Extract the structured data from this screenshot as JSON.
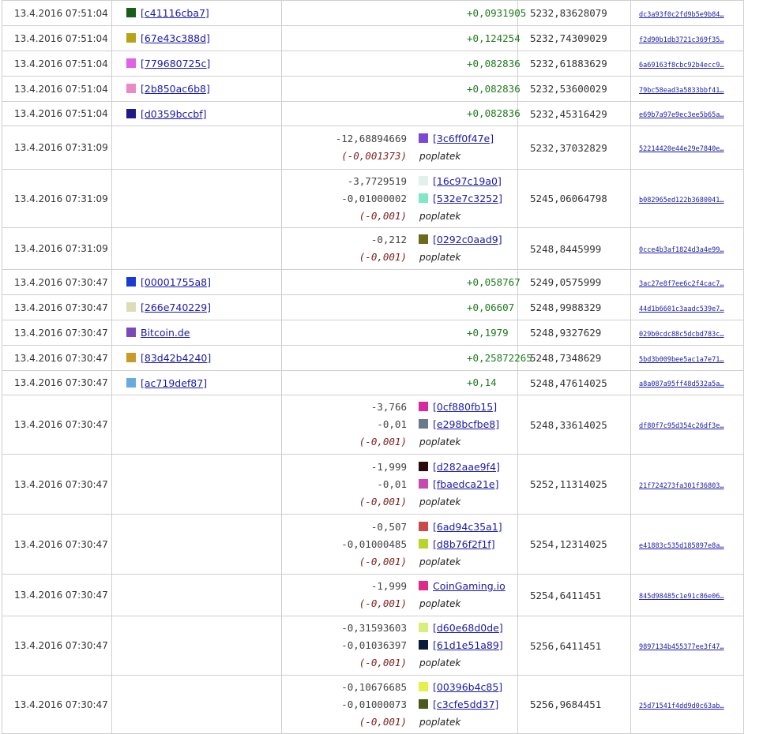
{
  "rows": [
    {
      "date": "13.4.2016 07:51:04",
      "wallet_color": "#1a5c1a",
      "wallet": "[c41116cba7]",
      "amount": "+0,0931905",
      "balance": "5232,83628079",
      "txid": "dc3a93f0c2fd9b5e9b84…"
    },
    {
      "date": "13.4.2016 07:51:04",
      "wallet_color": "#b8a21a",
      "wallet": "[67e43c388d]",
      "amount": "+0,124254",
      "balance": "5232,74309029",
      "txid": "f2d90b1db3721c369f35…"
    },
    {
      "date": "13.4.2016 07:51:04",
      "wallet_color": "#e060e6",
      "wallet": "[779680725c]",
      "amount": "+0,082836",
      "balance": "5232,61883629",
      "txid": "6a69163f8cbc92b4ecc9…"
    },
    {
      "date": "13.4.2016 07:51:04",
      "wallet_color": "#e88ac6",
      "wallet": "[2b850ac6b8]",
      "amount": "+0,082836",
      "balance": "5232,53600029",
      "txid": "79bc58ead3a5833bbf41…"
    },
    {
      "date": "13.4.2016 07:51:04",
      "wallet_color": "#1e1a8a",
      "wallet": "[d0359bccbf]",
      "amount": "+0,082836",
      "balance": "5232,45316429",
      "txid": "e69b7a97e9ec3ee5b65a…"
    },
    {
      "date": "13.4.2016 07:31:09",
      "outs": [
        {
          "amount": "-12,68894669",
          "color": "#7a4ad6",
          "addr": "[3c6ff0f47e]"
        }
      ],
      "fee": "(-0,001373)",
      "fee_label": "poplatek",
      "balance": "5232,37032829",
      "txid": "52214420e44e29e7840e…"
    },
    {
      "date": "13.4.2016 07:31:09",
      "outs": [
        {
          "amount": "-3,7729519",
          "color": "#e0f0ea",
          "addr": "[16c97c19a0]"
        },
        {
          "amount": "-0,01000002",
          "color": "#7ee8c6",
          "addr": "[532e7c3252]"
        }
      ],
      "fee": "(-0,001)",
      "fee_label": "poplatek",
      "balance": "5245,06064798",
      "txid": "b082965ed122b3680041…"
    },
    {
      "date": "13.4.2016 07:31:09",
      "outs": [
        {
          "amount": "-0,212",
          "color": "#6a6a1a",
          "addr": "[0292c0aad9]"
        }
      ],
      "fee": "(-0,001)",
      "fee_label": "poplatek",
      "balance": "5248,8445999",
      "txid": "0cce4b3af1824d3a4e99…"
    },
    {
      "date": "13.4.2016 07:30:47",
      "wallet_color": "#1a3ad6",
      "wallet": "[00001755a8]",
      "amount": "+0,058767",
      "balance": "5249,0575999",
      "txid": "3ac27e8f7ee6c2f4cac7…"
    },
    {
      "date": "13.4.2016 07:30:47",
      "wallet_color": "#dedcb8",
      "wallet": "[266e740229]",
      "amount": "+0,06607",
      "balance": "5248,9988329",
      "txid": "44d1b6601c3aadc539e7…"
    },
    {
      "date": "13.4.2016 07:30:47",
      "wallet_color": "#7a4ab8",
      "wallet": "Bitcoin.de",
      "amount": "+0,1979",
      "balance": "5248,9327629",
      "txid": "029b0cdc88c5dcbd783c…"
    },
    {
      "date": "13.4.2016 07:30:47",
      "wallet_color": "#c89a2a",
      "wallet": "[83d42b4240]",
      "amount": "+0,25872265",
      "balance": "5248,7348629",
      "txid": "5bd3b009bee5ac1a7e71…"
    },
    {
      "date": "13.4.2016 07:30:47",
      "wallet_color": "#6aaade",
      "wallet": "[ac719def87]",
      "amount": "+0,14",
      "balance": "5248,47614025",
      "txid": "a8a087a95ff48d532a5a…"
    },
    {
      "date": "13.4.2016 07:30:47",
      "outs": [
        {
          "amount": "-3,766",
          "color": "#d62a9e",
          "addr": "[0cf880fb15]"
        },
        {
          "amount": "-0,01",
          "color": "#6a7a8a",
          "addr": "[e298bcfbe8]"
        }
      ],
      "fee": "(-0,001)",
      "fee_label": "poplatek",
      "balance": "5248,33614025",
      "txid": "df80f7c95d354c26df3e…"
    },
    {
      "date": "13.4.2016 07:30:47",
      "outs": [
        {
          "amount": "-1,999",
          "color": "#2a0a0a",
          "addr": "[d282aae9f4]"
        },
        {
          "amount": "-0,01",
          "color": "#c84ab0",
          "addr": "[fbaedca21e]"
        }
      ],
      "fee": "(-0,001)",
      "fee_label": "poplatek",
      "balance": "5252,11314025",
      "txid": "21f724273fa301f36803…"
    },
    {
      "date": "13.4.2016 07:30:47",
      "outs": [
        {
          "amount": "-0,507",
          "color": "#c84a4a",
          "addr": "[6ad94c35a1]"
        },
        {
          "amount": "-0,01000485",
          "color": "#b8d62a",
          "addr": "[d8b76f2f1f]"
        }
      ],
      "fee": "(-0,001)",
      "fee_label": "poplatek",
      "balance": "5254,12314025",
      "txid": "e41883c535d185897e8a…"
    },
    {
      "date": "13.4.2016 07:30:47",
      "outs": [
        {
          "amount": "-1,999",
          "color": "#e02a8a",
          "addr": "CoinGaming.io"
        }
      ],
      "fee": "(-0,001)",
      "fee_label": "poplatek",
      "balance": "5254,6411451",
      "txid": "845d98485c1e91c86e06…"
    },
    {
      "date": "13.4.2016 07:30:47",
      "outs": [
        {
          "amount": "-0,31593603",
          "color": "#d6f07a",
          "addr": "[d60e68d0de]"
        },
        {
          "amount": "-0,01036397",
          "color": "#0a1a3a",
          "addr": "[61d1e51a89]"
        }
      ],
      "fee": "(-0,001)",
      "fee_label": "poplatek",
      "balance": "5256,6411451",
      "txid": "9897134b455377ee3f47…"
    },
    {
      "date": "13.4.2016 07:30:47",
      "outs": [
        {
          "amount": "-0,10676685",
          "color": "#e6f04a",
          "addr": "[00396b4c85]"
        },
        {
          "amount": "-0,01000073",
          "color": "#4a5a1a",
          "addr": "[c3cfe5dd37]"
        }
      ],
      "fee": "(-0,001)",
      "fee_label": "poplatek",
      "balance": "5256,9684451",
      "txid": "25d71541f4dd9d0c63ab…"
    }
  ]
}
